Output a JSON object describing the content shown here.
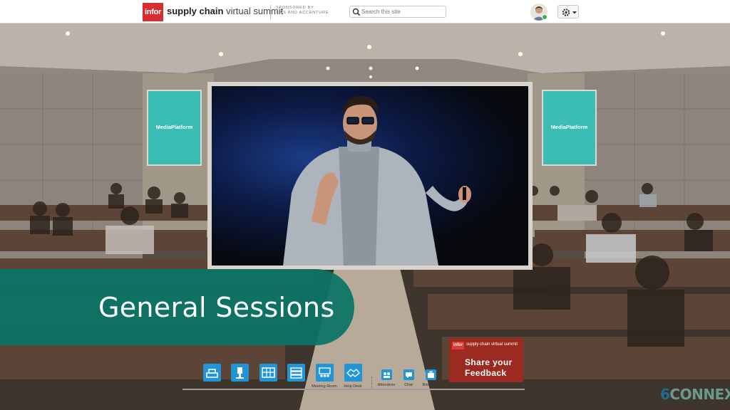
{
  "header": {
    "logo_text": "infor",
    "brand_bold": "supply chain",
    "brand_light": "virtual summit",
    "sponsor_line1": "SPONSORED BY",
    "sponsor_line2": "AWS AND ACCENTURE",
    "search_placeholder": "Search this site",
    "search_icon": "search-icon",
    "avatar_status_color": "#35b34a",
    "settings_icon": "gear-icon"
  },
  "scene": {
    "side_screen_left": "MediaPlatform",
    "side_screen_right": "MediaPlatform",
    "stage_content": "speaker video"
  },
  "banner": {
    "title": "General Sessions",
    "color": "#0a7465"
  },
  "feedback": {
    "logo_text": "infor",
    "brand": "supply chain virtual summit",
    "line1": "Share your",
    "line2": "Feedback",
    "color": "#9b2b20"
  },
  "nav": {
    "items": [
      {
        "label": "Lobby",
        "icon": "lobby-icon"
      },
      {
        "label": "Auditorium",
        "icon": "auditorium-icon"
      },
      {
        "label": "Exhibit Hall",
        "icon": "exhibit-hall-icon"
      },
      {
        "label": "Resource Center",
        "icon": "resource-center-icon"
      },
      {
        "label": "Meeting Room",
        "icon": "meeting-room-icon"
      },
      {
        "label": "Help Desk",
        "icon": "help-desk-icon"
      },
      {
        "label": "Attendees",
        "icon": "attendees-icon"
      },
      {
        "label": "Chat",
        "icon": "chat-icon"
      },
      {
        "label": "Briefcase",
        "icon": "briefcase-icon"
      }
    ],
    "accent": "#2294d8"
  },
  "footer": {
    "brand_6": "6",
    "brand_rest": "CONNEX"
  }
}
